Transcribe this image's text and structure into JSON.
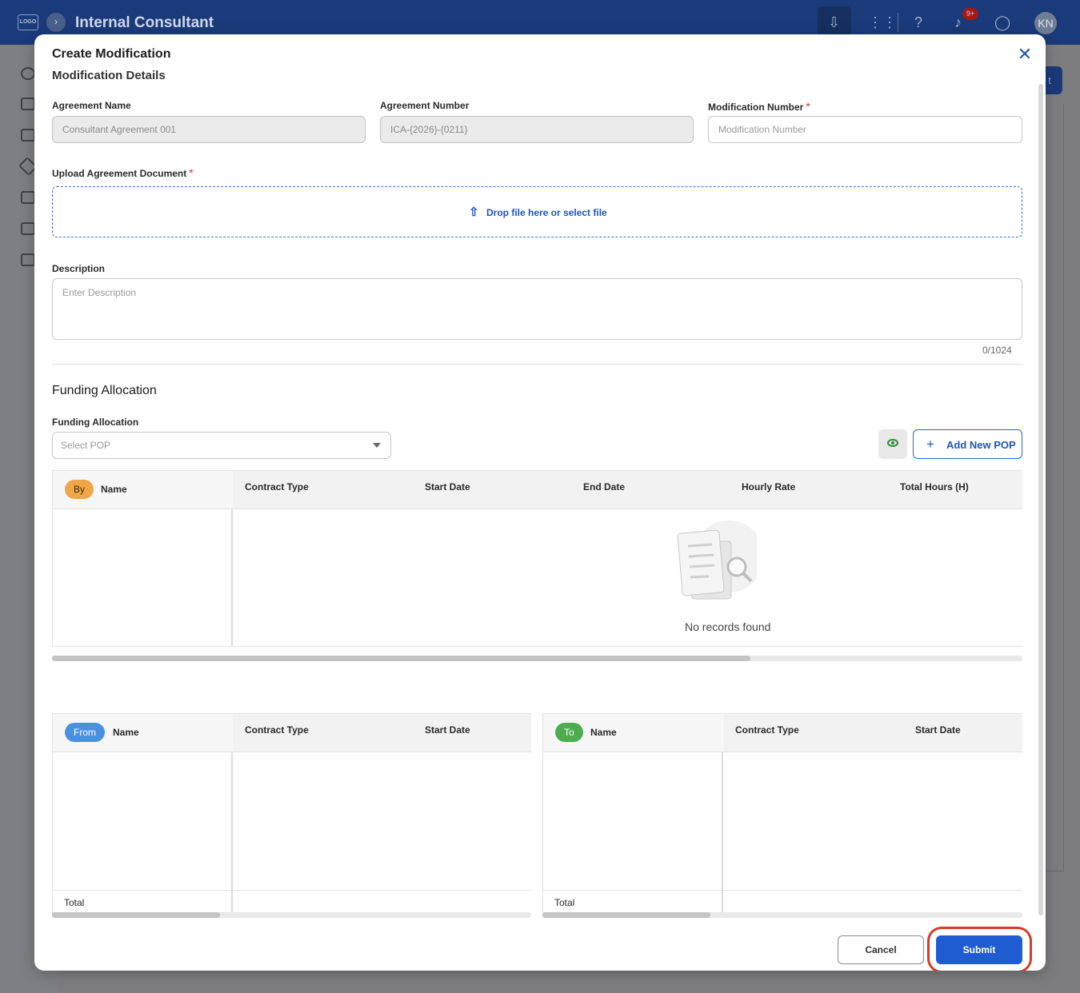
{
  "app": {
    "logo_text": "LOGO",
    "title": "Internal Consultant",
    "notification_count": "9+",
    "avatar_initials": "KN",
    "content_button_text": "t"
  },
  "modal": {
    "title": "Create Modification",
    "section_title": "Modification Details",
    "agreement_name": {
      "label": "Agreement Name",
      "value": "Consultant Agreement 001"
    },
    "agreement_number": {
      "label": "Agreement Number",
      "value": "ICA-{2026}-{0211}"
    },
    "modification_number": {
      "label": "Modification Number",
      "placeholder": "Modification Number",
      "value": ""
    },
    "upload": {
      "label": "Upload Agreement Document",
      "dropzone_text": "Drop file here or select file"
    },
    "description": {
      "label": "Description",
      "placeholder": "Enter Description",
      "char_count": "0/1024"
    },
    "funding": {
      "heading": "Funding Allocation",
      "select_label": "Funding Allocation",
      "select_placeholder": "Select POP",
      "add_pop_label": "Add New POP",
      "by_table": {
        "pill": "By",
        "name_header": "Name",
        "columns": [
          "Contract Type",
          "Start Date",
          "End Date",
          "Hourly Rate",
          "Total Hours (H)"
        ],
        "empty_text": "No records found",
        "scroll_fraction": 0.72
      },
      "from_table": {
        "pill": "From",
        "name_header": "Name",
        "columns": [
          "Contract Type",
          "Start Date"
        ],
        "total_label": "Total",
        "scroll_fraction": 0.35
      },
      "to_table": {
        "pill": "To",
        "name_header": "Name",
        "columns": [
          "Contract Type",
          "Start Date"
        ],
        "total_label": "Total",
        "scroll_fraction": 0.35
      }
    },
    "actions": {
      "cancel": "Cancel",
      "submit": "Submit"
    }
  },
  "colors": {
    "brand": "#1a3a7a",
    "accent": "#1f5bd1",
    "required": "#d93030",
    "highlight": "#d93a2a"
  }
}
